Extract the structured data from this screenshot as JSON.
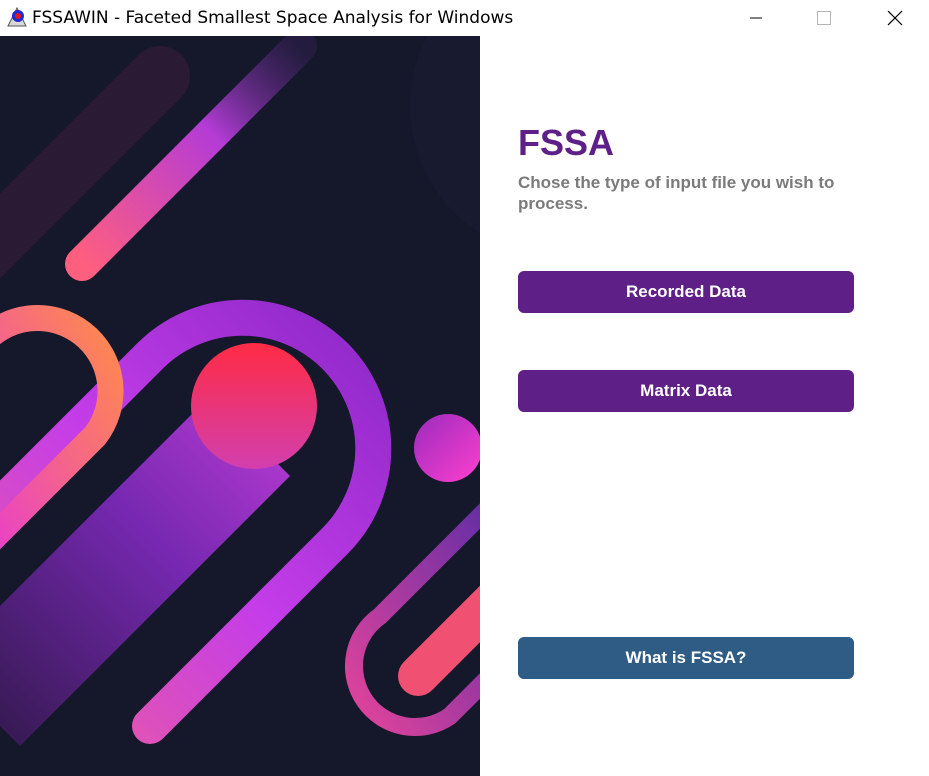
{
  "window": {
    "title": "FSSAWIN - Faceted Smallest Space Analysis for Windows",
    "app_icon": "fssa-app-icon",
    "controls": [
      "minimize-icon",
      "maximize-icon",
      "close-icon"
    ]
  },
  "content": {
    "heading": "FSSA",
    "subtitle": "Chose the type of input file you wish to process.",
    "buttons": {
      "recorded": "Recorded Data",
      "matrix": "Matrix Data",
      "what_is": "What is FSSA?"
    }
  },
  "colors": {
    "primary_purple": "#5e1f86",
    "info_blue": "#2f5c85",
    "subtitle_gray": "#7b7b7b",
    "art_background": "#15172a"
  }
}
